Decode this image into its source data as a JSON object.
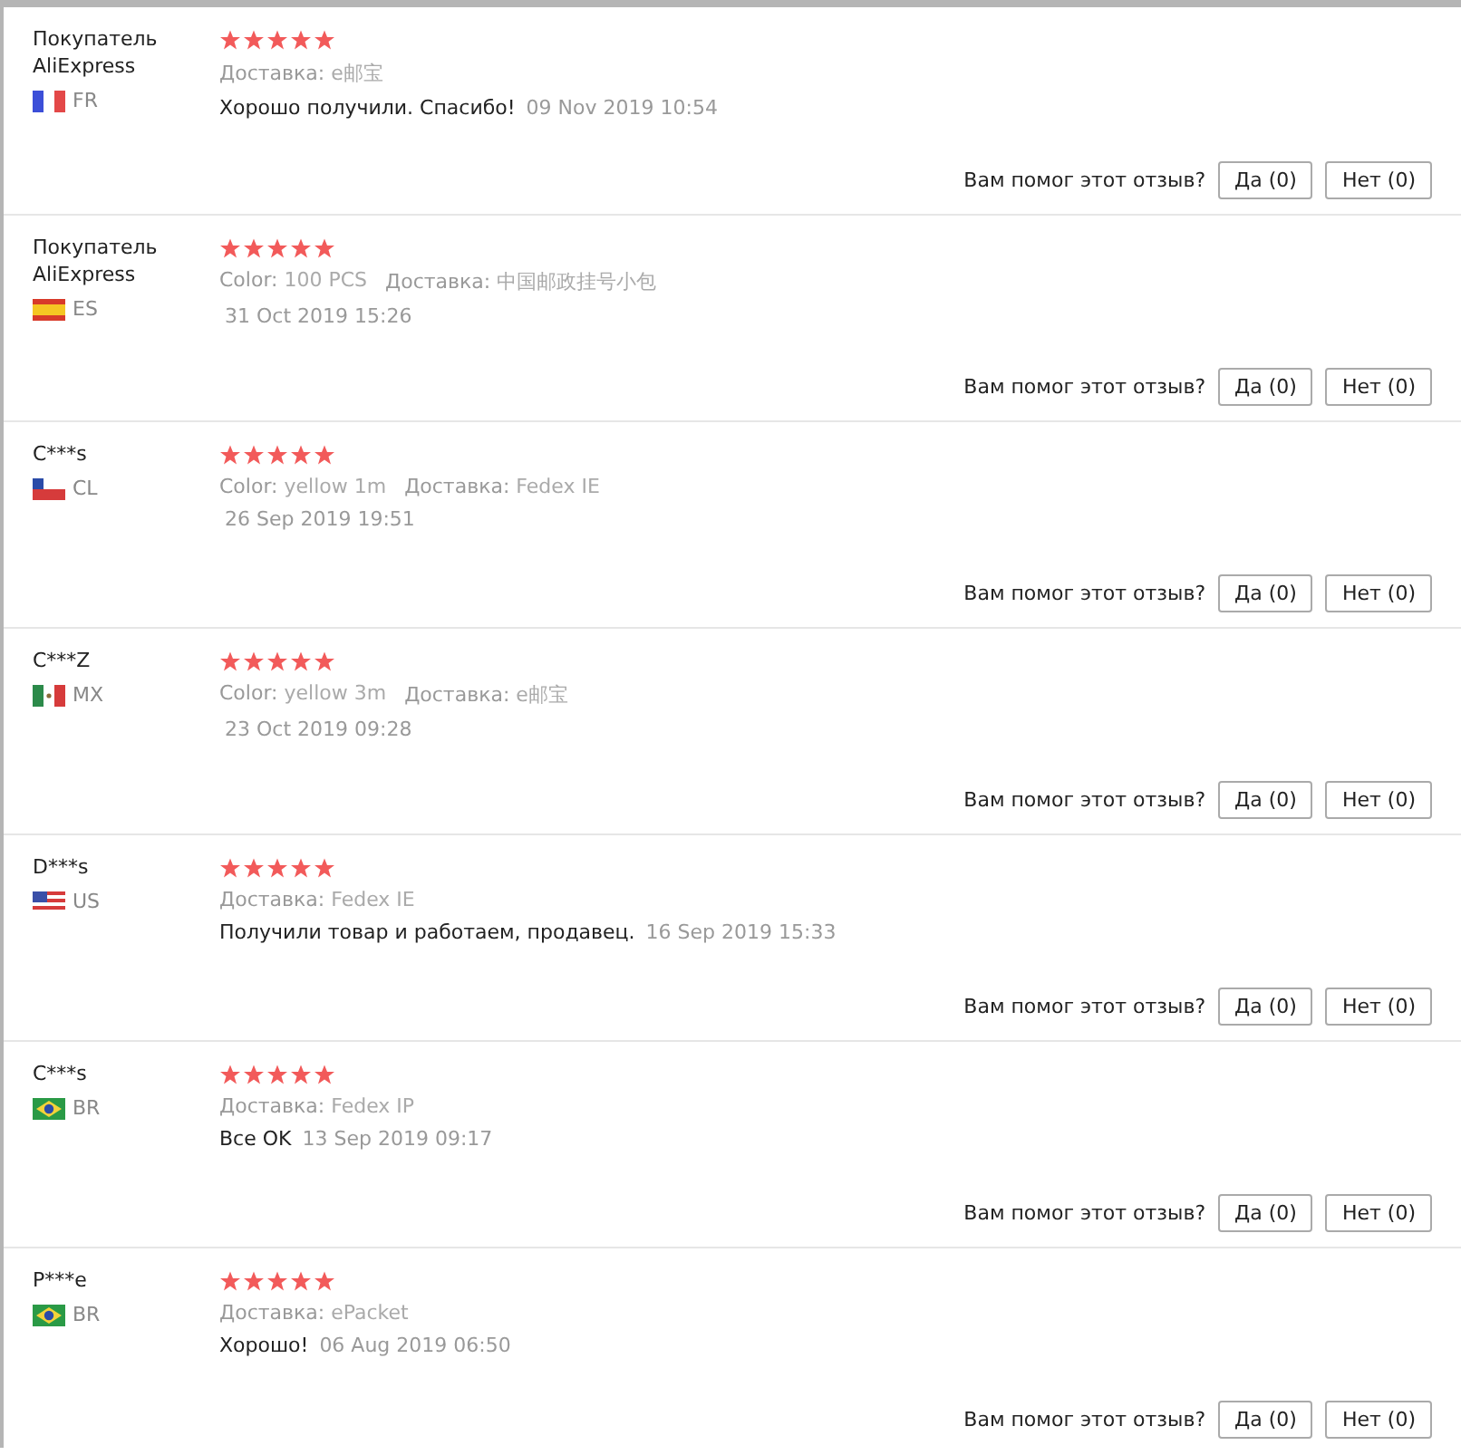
{
  "reviews": [
    {
      "author": "Покупатель AliExpress",
      "kind": "fr",
      "country": "FR",
      "stars": 5,
      "meta": [
        {
          "label": "Доставка:",
          "value": "e邮宝"
        }
      ],
      "text": "Хорошо получили. Спасибо!",
      "date": "09 Nov 2019 10:54",
      "prompt": "Вам помог этот отзыв?",
      "yes": "Да (0)",
      "no": "Нет (0)"
    },
    {
      "author": "Покупатель AliExpress",
      "kind": "es",
      "country": "ES",
      "stars": 5,
      "meta": [
        {
          "label": "Color:",
          "value": "100 PCS"
        },
        {
          "label": "Доставка:",
          "value": "中国邮政挂号小包"
        }
      ],
      "date": "31 Oct 2019 15:26",
      "prompt": "Вам помог этот отзыв?",
      "yes": "Да (0)",
      "no": "Нет (0)"
    },
    {
      "author": "C***s",
      "kind": "cl",
      "country": "CL",
      "stars": 5,
      "meta": [
        {
          "label": "Color:",
          "value": "yellow 1m"
        },
        {
          "label": "Доставка:",
          "value": "Fedex IE"
        }
      ],
      "date": "26 Sep 2019 19:51",
      "prompt": "Вам помог этот отзыв?",
      "yes": "Да (0)",
      "no": "Нет (0)"
    },
    {
      "author": "C***Z",
      "kind": "mx",
      "country": "MX",
      "stars": 5,
      "meta": [
        {
          "label": "Color:",
          "value": "yellow 3m"
        },
        {
          "label": "Доставка:",
          "value": "e邮宝"
        }
      ],
      "date": "23 Oct 2019 09:28",
      "prompt": "Вам помог этот отзыв?",
      "yes": "Да (0)",
      "no": "Нет (0)"
    },
    {
      "author": "D***s",
      "kind": "us",
      "country": "US",
      "stars": 5,
      "meta": [
        {
          "label": "Доставка:",
          "value": "Fedex IE"
        }
      ],
      "text": "Получили товар и работаем, продавец.",
      "date": "16 Sep 2019 15:33",
      "prompt": "Вам помог этот отзыв?",
      "yes": "Да (0)",
      "no": "Нет (0)"
    },
    {
      "author": "C***s",
      "kind": "br",
      "country": "BR",
      "stars": 5,
      "meta": [
        {
          "label": "Доставка:",
          "value": "Fedex IP"
        }
      ],
      "text": "Все OK",
      "date": "13 Sep 2019 09:17",
      "prompt": "Вам помог этот отзыв?",
      "yes": "Да (0)",
      "no": "Нет (0)"
    },
    {
      "author": "P***e",
      "kind": "br",
      "country": "BR",
      "stars": 5,
      "meta": [
        {
          "label": "Доставка:",
          "value": "ePacket"
        }
      ],
      "text": "Хорошо!",
      "date": "06 Aug 2019 06:50",
      "prompt": "Вам помог этот отзыв?",
      "yes": "Да (0)",
      "no": "Нет (0)"
    }
  ]
}
